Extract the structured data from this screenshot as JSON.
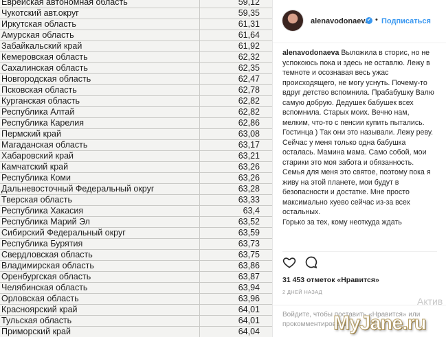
{
  "table": {
    "rows": [
      {
        "region": "Еврейская автономная область",
        "value": "59,12"
      },
      {
        "region": "Чукотский авт.округ",
        "value": "59,35"
      },
      {
        "region": "Иркутская область",
        "value": "61,31"
      },
      {
        "region": "Амурская область",
        "value": "61,64"
      },
      {
        "region": "Забайкальский край",
        "value": "61,92"
      },
      {
        "region": "Кемеровская область",
        "value": "62,32"
      },
      {
        "region": "Сахалинская область",
        "value": "62,35"
      },
      {
        "region": "Новгородская область",
        "value": "62,47"
      },
      {
        "region": "Псковская область",
        "value": "62,78"
      },
      {
        "region": "Курганская область",
        "value": "62,82"
      },
      {
        "region": "Республика Алтай",
        "value": "62,82"
      },
      {
        "region": "Республика Карелия",
        "value": "62,86"
      },
      {
        "region": "Пермский край",
        "value": "63,08"
      },
      {
        "region": "Магаданская область",
        "value": "63,17"
      },
      {
        "region": "Хабаровский край",
        "value": "63,21"
      },
      {
        "region": "Камчатский край",
        "value": "63,26"
      },
      {
        "region": "Республика Коми",
        "value": "63,26"
      },
      {
        "region": "Дальневосточный Федеральный округ",
        "value": "63,28"
      },
      {
        "region": "Тверская область",
        "value": "63,33"
      },
      {
        "region": "Республика Хакасия",
        "value": "63,4"
      },
      {
        "region": "Республика Марий Эл",
        "value": "63,52"
      },
      {
        "region": "Сибирский Федеральный округ",
        "value": "63,59"
      },
      {
        "region": "Республика Бурятия",
        "value": "63,73"
      },
      {
        "region": "Свердловская область",
        "value": "63,75"
      },
      {
        "region": "Владимирская область",
        "value": "63,86"
      },
      {
        "region": "Оренбургская область",
        "value": "63,87"
      },
      {
        "region": "Челябинская область",
        "value": "63,94"
      },
      {
        "region": "Орловская область",
        "value": "63,96"
      },
      {
        "region": "Красноярский край",
        "value": "64,01"
      },
      {
        "region": "Тульская область",
        "value": "64,01"
      },
      {
        "region": "Приморский край",
        "value": "64,04"
      }
    ]
  },
  "post": {
    "username": "alenavodonaeva",
    "verified_icon": "✔",
    "separator": "•",
    "follow_label": "Подписаться",
    "caption_author": "alenavodonaeva",
    "caption_text": " Выложила в сторис, но не успокоюсь пока и здесь не оставлю. Лежу в темноте и осознавая весь ужас происходящего, не могу уснуть. Почему-то вдруг детство вспомнила. Прабабушку Валю самую добрую. Дедушек бабушек всех вспомнила. Старых моих. Вечно нам, мелким, что-то с пенсии купить пытались. Гостинца ) Так они это называли. Лежу реву.\nСейчас у меня только одна бабушка осталась. Мамина мама. Само собой, мои старики это моя забота и обязанность. Семья для меня это святое, поэтому пока я живу на этой планете, мои будут в безопасности и достатке. Мне просто максимально хуево сейчас из-за всех остальных.\nГорько за тех, кому неоткуда ждать",
    "likes": "31 453 отметок «Нравится»",
    "time": "2 ДНЕЙ НАЗАД",
    "footer_link": "Войдите",
    "footer_text": ", чтобы поставить «Нравится» или прокомментировать."
  },
  "overlay": {
    "activate_text": "Актив",
    "watermark": "MyJane.ru"
  },
  "colors": {
    "accent": "#3897f0",
    "table_bg": "#f3f3f1"
  }
}
